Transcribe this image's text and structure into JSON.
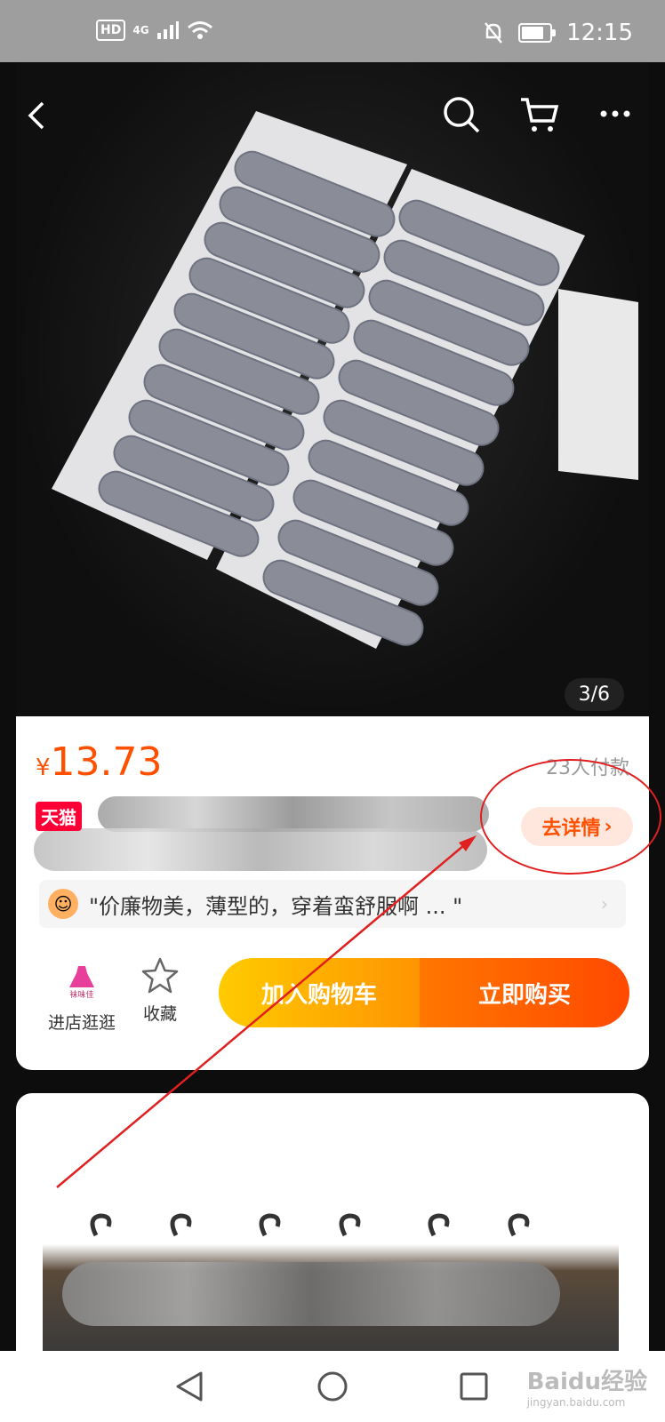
{
  "status_bar": {
    "hd": "HD",
    "signal": "4G",
    "time": "12:15"
  },
  "hero": {
    "counter": "3/6"
  },
  "product": {
    "currency": "¥",
    "price": "13.73",
    "sold": "23人付款",
    "tmall_badge": "天猫",
    "detail_button": "去详情",
    "review": "\"价廉物美，薄型的，穿着蛮舒服啊 ...    \"",
    "shop_logo_text": "袜味佳",
    "shop_label": "进店逛逛",
    "favorite_label": "收藏",
    "add_to_cart": "加入购物车",
    "buy_now": "立即购买"
  },
  "watermark": {
    "brand": "Baidu经验",
    "url": "jingyan.baidu.com"
  },
  "colors": {
    "accent": "#ff5000",
    "tmall": "#ff0036",
    "annotation": "#e02020"
  }
}
